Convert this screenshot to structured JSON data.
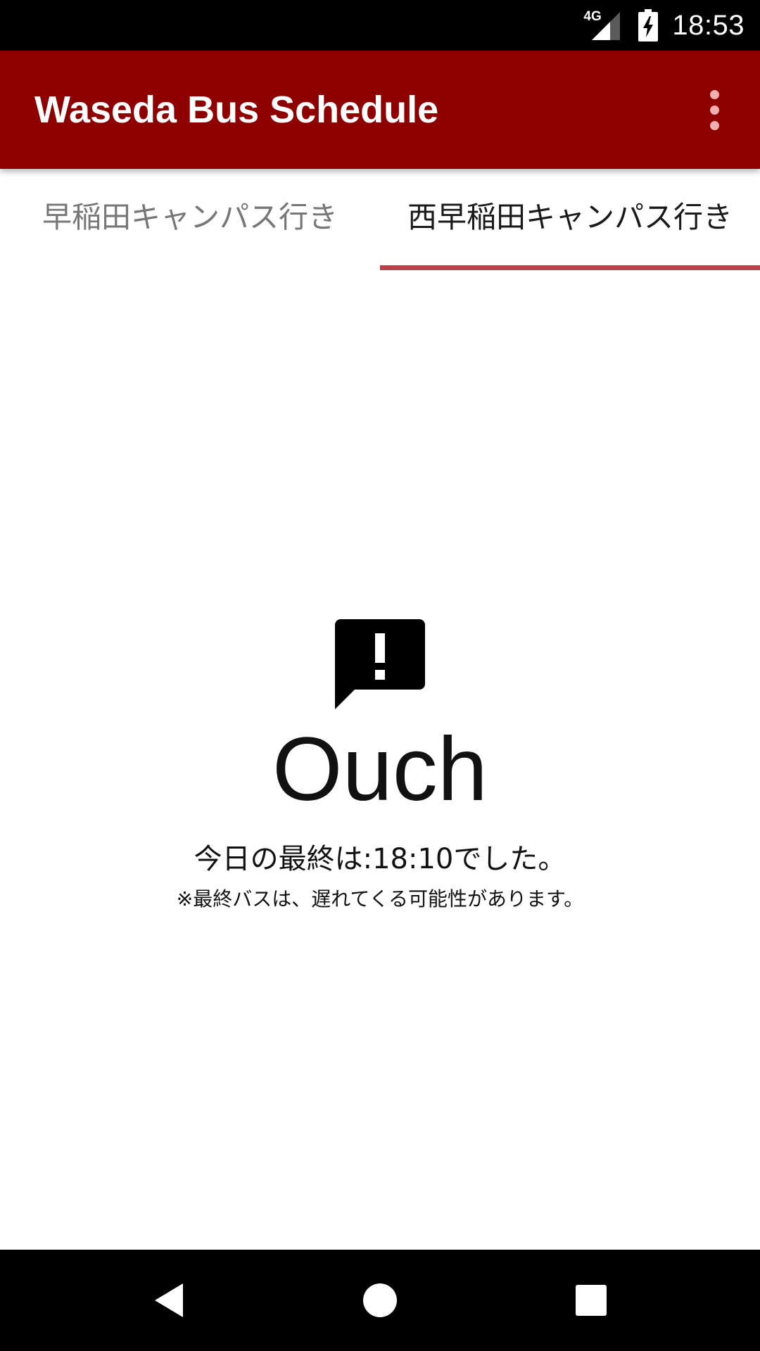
{
  "status_bar": {
    "network_type": "4G",
    "time": "18:53",
    "icons": [
      "signal-icon",
      "battery-charging-icon"
    ]
  },
  "app_bar": {
    "title": "Waseda Bus Schedule",
    "menu_icon": "overflow-menu-icon",
    "background_color": "#8e0000"
  },
  "tabs": [
    {
      "label": "早稲田キャンパス行き",
      "selected": false
    },
    {
      "label": "西早稲田キャンパス行き",
      "selected": true
    }
  ],
  "tab_indicator_color": "#b8434a",
  "empty_state": {
    "icon": "alert-message-icon",
    "heading": "Ouch",
    "message": "今日の最終は:18:10でした。",
    "note": "※最終バスは、遅れてくる可能性があります。"
  },
  "nav_bar": {
    "buttons": [
      "back-icon",
      "home-icon",
      "recent-apps-icon"
    ]
  }
}
